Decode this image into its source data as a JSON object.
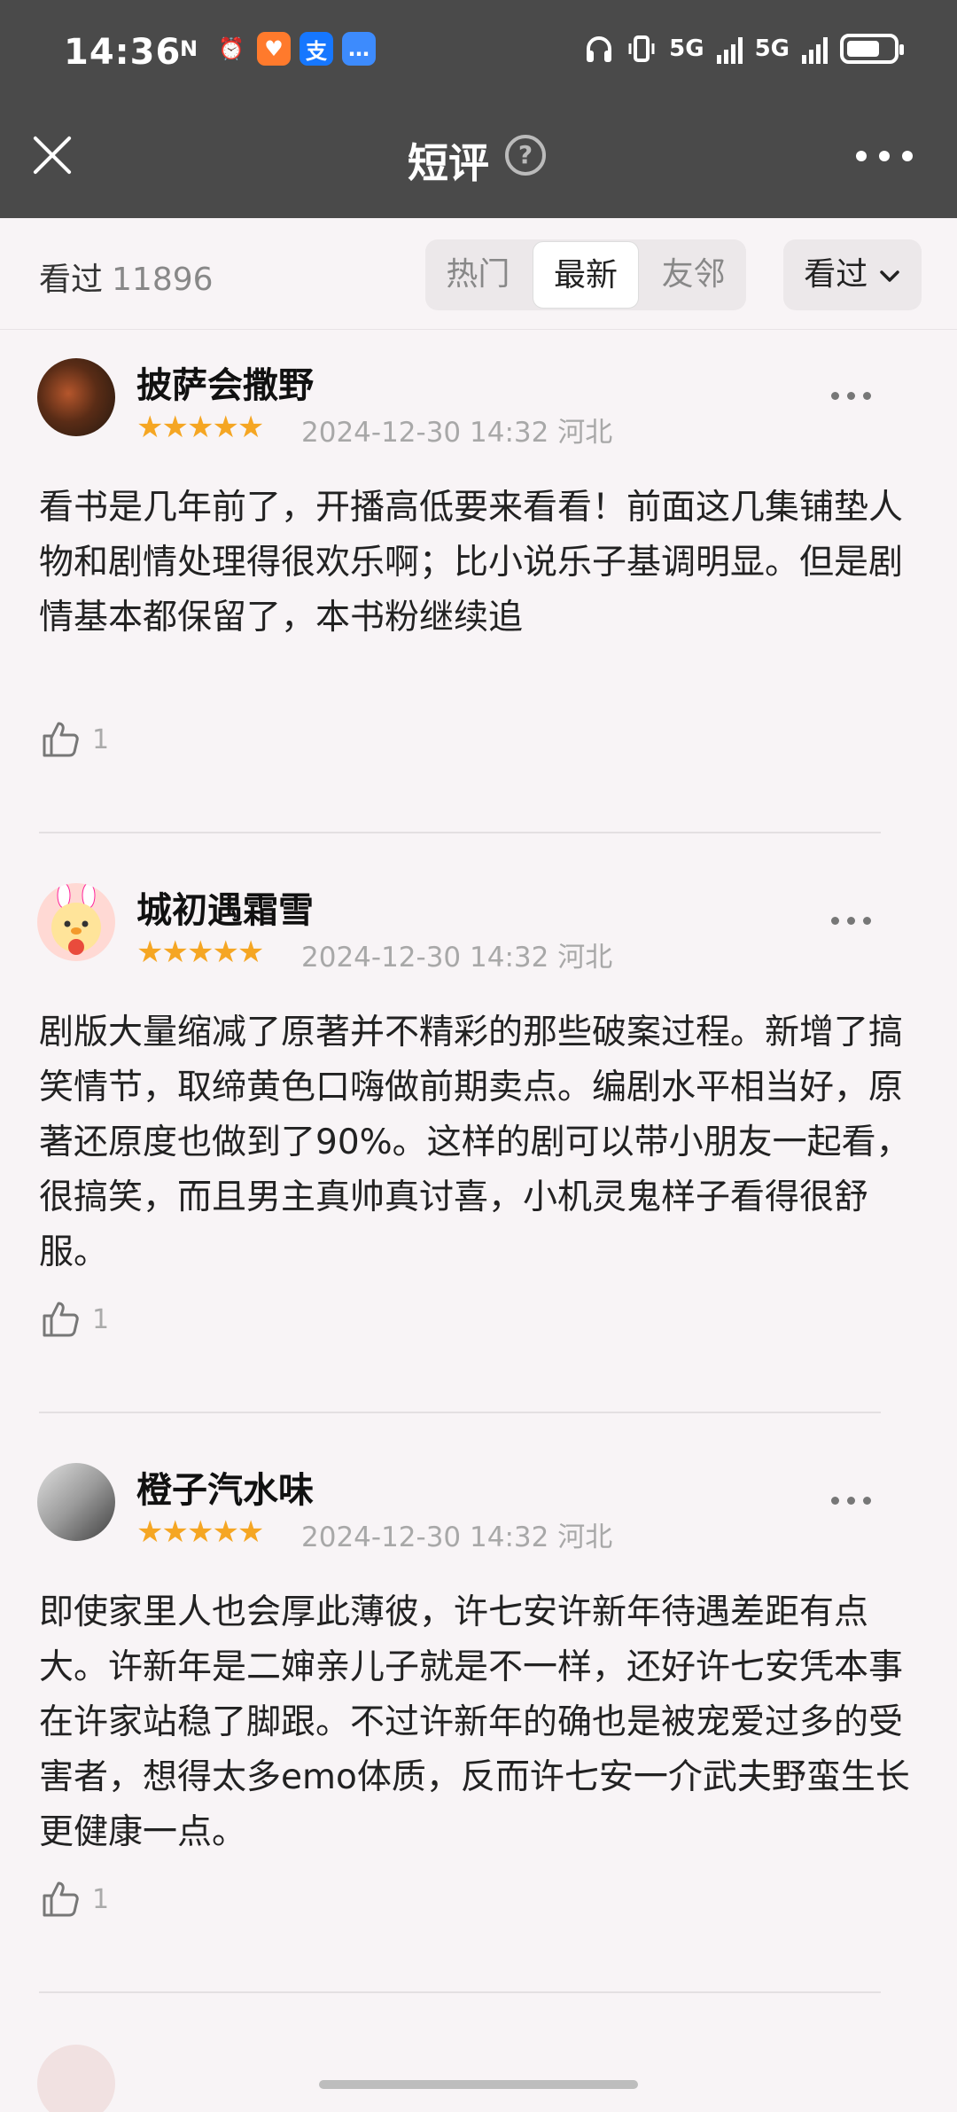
{
  "status_bar": {
    "time": "14:36",
    "apps": [
      {
        "icon": "n-icon",
        "glyph": "N",
        "color": "#4a4a4a"
      },
      {
        "icon": "alarm-icon",
        "glyph": "⏰",
        "color": "#4a4a4a"
      },
      {
        "icon": "taobao-icon",
        "glyph": "♥",
        "color": "#ff7a2c"
      },
      {
        "icon": "alipay-icon",
        "glyph": "支",
        "color": "#1677ff"
      },
      {
        "icon": "message-icon",
        "glyph": "…",
        "color": "#3d8bfd"
      }
    ],
    "network_1": "5G",
    "network_2": "5G"
  },
  "header": {
    "title": "短评",
    "help": "?"
  },
  "filter": {
    "seen_label": "看过",
    "seen_count": "11896",
    "tabs": [
      {
        "label": "热门",
        "active": false
      },
      {
        "label": "最新",
        "active": true
      },
      {
        "label": "友邻",
        "active": false
      }
    ],
    "dropdown_label": "看过",
    "dropdown_arrow": "⌄"
  },
  "reviews": [
    {
      "user": "披萨会撒野",
      "stars": "★★★★★",
      "meta": "2024-12-30 14:32 河北",
      "text": "看书是几年前了，开播高低要来看看！前面这几集铺垫人物和剧情处理得很欢乐啊；比小说乐子基调明显。但是剧情基本都保留了，本书粉继续追",
      "likes": "1",
      "avatar_colors": [
        "#3a2a1e",
        "#7a3b22"
      ]
    },
    {
      "user": "城初遇霜雪",
      "stars": "★★★★★",
      "meta": "2024-12-30 14:32 河北",
      "text": "剧版大量缩减了原著并不精彩的那些破案过程。新增了搞笑情节，取缔黄色口嗨做前期卖点。编剧水平相当好，原著还原度也做到了90%。这样的剧可以带小朋友一起看，很搞笑，而且男主真帅真讨喜，小机灵鬼样子看得很舒服。",
      "likes": "1",
      "avatar_colors": [
        "#ffe9a8",
        "#e94b3c"
      ]
    },
    {
      "user": "橙子汽水味",
      "stars": "★★★★★",
      "meta": "2024-12-30 14:32 河北",
      "text": "即使家里人也会厚此薄彼，许七安许新年待遇差距有点大。许新年是二婶亲儿子就是不一样，还好许七安凭本事在许家站稳了脚跟。不过许新年的确也是被宠爱过多的受害者，想得太多emo体质，反而许七安一介武夫野蛮生长更健康一点。",
      "likes": "1",
      "avatar_colors": [
        "#c9c9c9",
        "#5d5d5d"
      ]
    }
  ]
}
